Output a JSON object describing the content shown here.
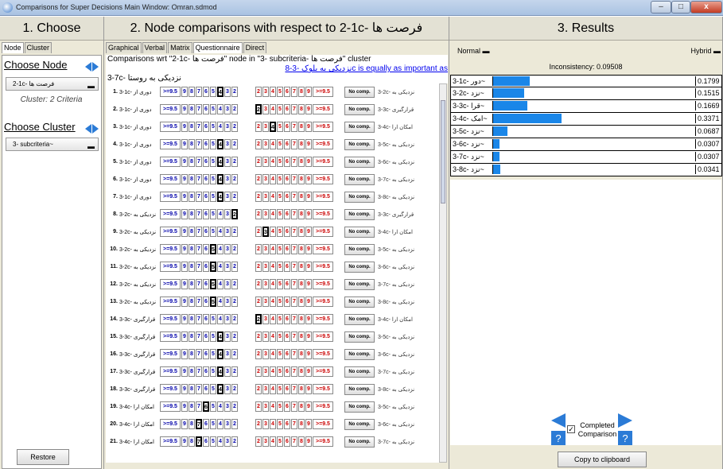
{
  "window": {
    "title": "Comparisons for Super Decisions Main Window: Omran.sdmod",
    "minimize": "–",
    "maximize": "□",
    "close": "x"
  },
  "choose": {
    "header": "1. Choose",
    "tabs": [
      "Node",
      "Cluster"
    ],
    "choose_node_label": "Choose Node",
    "node_value": "2-1c- فرصت ها",
    "cluster_info": "Cluster: 2 Criteria",
    "choose_cluster_label": "Choose Cluster",
    "cluster_value": "3- subcriteria~",
    "restore": "Restore"
  },
  "comparisons": {
    "header": "2. Node comparisons with respect to 2-1c- فرصت ها",
    "tabs": [
      "Graphical",
      "Verbal",
      "Matrix",
      "Questionnaire",
      "Direct"
    ],
    "desc_line1": "Comparisons wrt \"2-1c- فرصت ها\" node in \"3- subcriteria- فرصت ها\" cluster",
    "desc_link_text": "نزدیکی به بلوک -3-8c is equally as important as",
    "desc_line2_end": "3-7c- نزدیکی به روستا",
    "scale_left": [
      ">=9.5",
      "9",
      "8",
      "7",
      "6",
      "5",
      "4",
      "3",
      "2"
    ],
    "scale_right": [
      "2",
      "3",
      "4",
      "5",
      "6",
      "7",
      "8",
      "9",
      ">=9.5"
    ],
    "no_comp": "No comp.",
    "rows": [
      {
        "num": "1.",
        "left": "3-1c- دوری از",
        "right": "3-2c- نزدیکی به",
        "sel": "L4"
      },
      {
        "num": "2.",
        "left": "3-1c- دوری از",
        "right": "3-3c- قرارگیری",
        "sel": "R2"
      },
      {
        "num": "3.",
        "left": "3-1c- دوری از",
        "right": "3-4c- امکان ارا",
        "sel": "R4"
      },
      {
        "num": "4.",
        "left": "3-1c- دوری از",
        "right": "3-5c- نزدیکی به",
        "sel": "L4"
      },
      {
        "num": "5.",
        "left": "3-1c- دوری از",
        "right": "3-6c- نزدیکی به",
        "sel": "L4"
      },
      {
        "num": "6.",
        "left": "3-1c- دوری از",
        "right": "3-7c- نزدیکی به",
        "sel": "L4"
      },
      {
        "num": "7.",
        "left": "3-1c- دوری از",
        "right": "3-8c- نزدیکی به",
        "sel": "L4"
      },
      {
        "num": "8.",
        "left": "3-2c- نزدیکی به",
        "right": "3-3c- قرارگیری",
        "sel": "L2"
      },
      {
        "num": "9.",
        "left": "3-2c- نزدیکی به",
        "right": "3-4c- امکان ارا",
        "sel": "R3"
      },
      {
        "num": "10.",
        "left": "3-2c- نزدیکی به",
        "right": "3-5c- نزدیکی به",
        "sel": "L5"
      },
      {
        "num": "11.",
        "left": "3-2c- نزدیکی به",
        "right": "3-6c- نزدیکی به",
        "sel": "L5"
      },
      {
        "num": "12.",
        "left": "3-2c- نزدیکی به",
        "right": "3-7c- نزدیکی به",
        "sel": "L5"
      },
      {
        "num": "13.",
        "left": "3-2c- نزدیکی به",
        "right": "3-8c- نزدیکی به",
        "sel": "L5"
      },
      {
        "num": "14.",
        "left": "3-3c- قرارگیری",
        "right": "3-4c- امکان ارا",
        "sel": "R2"
      },
      {
        "num": "15.",
        "left": "3-3c- قرارگیری",
        "right": "3-5c- نزدیکی به",
        "sel": "L4"
      },
      {
        "num": "16.",
        "left": "3-3c- قرارگیری",
        "right": "3-6c- نزدیکی به",
        "sel": "L4"
      },
      {
        "num": "17.",
        "left": "3-3c- قرارگیری",
        "right": "3-7c- نزدیکی به",
        "sel": "L4"
      },
      {
        "num": "18.",
        "left": "3-3c- قرارگیری",
        "right": "3-8c- نزدیکی به",
        "sel": "L4"
      },
      {
        "num": "19.",
        "left": "3-4c- امکان ارا",
        "right": "3-5c- نزدیکی به",
        "sel": "L6"
      },
      {
        "num": "20.",
        "left": "3-4c- امکان ارا",
        "right": "3-6c- نزدیکی به",
        "sel": "L7"
      },
      {
        "num": "21.",
        "left": "3-4c- امکان ارا",
        "right": "3-7c- نزدیکی به",
        "sel": "L7"
      }
    ]
  },
  "results": {
    "header": "3. Results",
    "normal": "Normal",
    "hybrid": "Hybrid",
    "inconsistency": "Inconsistency: 0.09508",
    "rows": [
      {
        "name": "3-1c- دور~",
        "value": "0.1799",
        "frac": 0.1799
      },
      {
        "name": "3-2c- نزد~",
        "value": "0.1515",
        "frac": 0.1515
      },
      {
        "name": "3-3c- قرا~",
        "value": "0.1669",
        "frac": 0.1669
      },
      {
        "name": "3-4c- امک~",
        "value": "0.3371",
        "frac": 0.3371
      },
      {
        "name": "3-5c- نزد~",
        "value": "0.0687",
        "frac": 0.0687
      },
      {
        "name": "3-6c- نزد~",
        "value": "0.0307",
        "frac": 0.0307
      },
      {
        "name": "3-7c- نزد~",
        "value": "0.0307",
        "frac": 0.0307
      },
      {
        "name": "3-8c- نزد~",
        "value": "0.0341",
        "frac": 0.0341
      }
    ],
    "completed_label": "Completed Comparison",
    "completed_checked": "✓",
    "copy": "Copy to clipboard",
    "colors": {
      "bar": "#1a86e8"
    }
  }
}
